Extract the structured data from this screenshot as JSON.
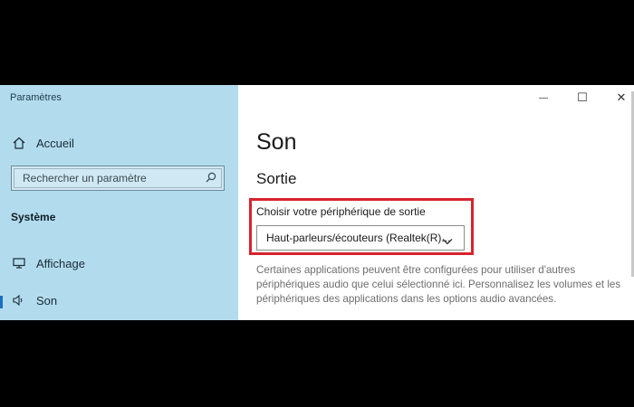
{
  "window": {
    "app_title": "Paramètres",
    "controls": {
      "minimize": "—",
      "maximize": "☐",
      "close": "✕"
    }
  },
  "sidebar": {
    "home_label": "Accueil",
    "search": {
      "placeholder": "Rechercher un paramètre"
    },
    "section_label": "Système",
    "items": [
      {
        "label": "Affichage",
        "icon": "monitor-icon"
      },
      {
        "label": "Son",
        "icon": "speaker-icon",
        "active": true
      }
    ]
  },
  "main": {
    "page_title": "Son",
    "section_title": "Sortie",
    "output_device": {
      "label": "Choisir votre périphérique de sortie",
      "selected": "Haut-parleurs/écouteurs (Realtek(R)..."
    },
    "description": "Certaines applications peuvent être configurées pour utiliser d'autres périphériques audio que celui sélectionné ici. Personnalisez les volumes et les périphériques des applications dans les options audio avancées."
  },
  "colors": {
    "sidebar_bg": "#b2dcee",
    "highlight_border": "#d7232d",
    "accent": "#1a6fc4"
  }
}
